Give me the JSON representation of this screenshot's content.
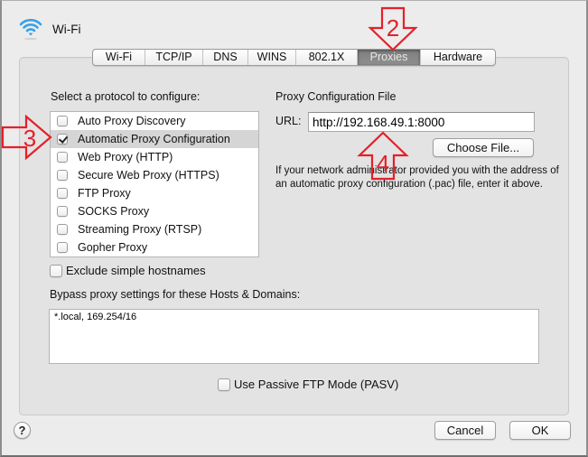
{
  "window": {
    "title": "Wi-Fi",
    "icon": "wifi-icon"
  },
  "tabs": [
    {
      "label": "Wi-Fi",
      "active": false
    },
    {
      "label": "TCP/IP",
      "active": false
    },
    {
      "label": "DNS",
      "active": false
    },
    {
      "label": "WINS",
      "active": false
    },
    {
      "label": "802.1X",
      "active": false
    },
    {
      "label": "Proxies",
      "active": true
    },
    {
      "label": "Hardware",
      "active": false
    }
  ],
  "protocols": {
    "heading": "Select a protocol to configure:",
    "items": [
      {
        "label": "Auto Proxy Discovery",
        "checked": false,
        "selected": false
      },
      {
        "label": "Automatic Proxy Configuration",
        "checked": true,
        "selected": true
      },
      {
        "label": "Web Proxy (HTTP)",
        "checked": false,
        "selected": false
      },
      {
        "label": "Secure Web Proxy (HTTPS)",
        "checked": false,
        "selected": false
      },
      {
        "label": "FTP Proxy",
        "checked": false,
        "selected": false
      },
      {
        "label": "SOCKS Proxy",
        "checked": false,
        "selected": false
      },
      {
        "label": "Streaming Proxy (RTSP)",
        "checked": false,
        "selected": false
      },
      {
        "label": "Gopher Proxy",
        "checked": false,
        "selected": false
      }
    ]
  },
  "exclude_simple_hostnames": {
    "label": "Exclude simple hostnames",
    "checked": false
  },
  "proxy_config": {
    "heading": "Proxy Configuration File",
    "url_label": "URL:",
    "url_value": "http://192.168.49.1:8000",
    "choose_file_label": "Choose File...",
    "help_text": "If your network administrator provided you with the address of an automatic proxy configuration (.pac) file, enter it above."
  },
  "bypass": {
    "label": "Bypass proxy settings for these Hosts & Domains:",
    "value": "*.local, 169.254/16"
  },
  "passive_ftp": {
    "label": "Use Passive FTP Mode (PASV)",
    "checked": false
  },
  "footer": {
    "help_label": "?",
    "cancel_label": "Cancel",
    "ok_label": "OK"
  },
  "annotations": [
    {
      "number": "2",
      "points_to": "Proxies tab",
      "direction": "down"
    },
    {
      "number": "3",
      "points_to": "Automatic Proxy Configuration",
      "direction": "right"
    },
    {
      "number": "4",
      "points_to": "URL field",
      "direction": "up"
    }
  ],
  "colors": {
    "window_bg": "#ececec",
    "panel_bg": "#e3e3e3",
    "selected_row": "#d5d5d5",
    "active_tab": "#868686",
    "annotation_red": "#e4202a",
    "wifi_blue": "#3aa0e6"
  }
}
